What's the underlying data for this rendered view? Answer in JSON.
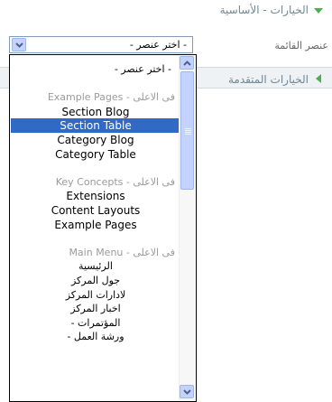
{
  "sections": {
    "basic_title": "الخيارات - الأساسية",
    "advanced_title": "الخيارات المتقدمة"
  },
  "menu_item_field": {
    "label": "عنصر القائمة",
    "selected_value": "- اختر عنصر -"
  },
  "dropdown": {
    "options": [
      {
        "text": "- اختر عنصر -",
        "kind": "first"
      },
      {
        "text": "",
        "kind": "blank"
      },
      {
        "text": "Example Pages - فى الاعلى",
        "kind": "group"
      },
      {
        "text": "Section Blog",
        "kind": "item"
      },
      {
        "text": "Section Table",
        "kind": "selected"
      },
      {
        "text": "Category Blog",
        "kind": "item"
      },
      {
        "text": "Category Table",
        "kind": "item"
      },
      {
        "text": "",
        "kind": "blank"
      },
      {
        "text": "Key Concepts - فى الاعلى",
        "kind": "group"
      },
      {
        "text": "Extensions",
        "kind": "item"
      },
      {
        "text": "Content Layouts",
        "kind": "item"
      },
      {
        "text": "Example Pages",
        "kind": "item"
      },
      {
        "text": "",
        "kind": "blank"
      },
      {
        "text": "Main Menu - فى الاعلى",
        "kind": "group"
      },
      {
        "text": "الرئيسية",
        "kind": "ar"
      },
      {
        "text": "جول المركز",
        "kind": "ar"
      },
      {
        "text": "لادارات المركز",
        "kind": "ar"
      },
      {
        "text": "اخبار المركز",
        "kind": "ar"
      },
      {
        "text": "- المؤتمرات",
        "kind": "ar"
      },
      {
        "text": "- ورشة العمل",
        "kind": "ar"
      }
    ],
    "scroll_position": 0
  },
  "colors": {
    "selection": "#316ac5",
    "section_title": "#6f8796",
    "triangle": "#4caf50",
    "scroll_button": "#c3d3fd"
  },
  "icons": {
    "section_open": "triangle-down-icon",
    "section_closed": "triangle-left-icon",
    "dropdown_arrow": "chevron-down-icon",
    "scroll_up": "chevron-up-icon",
    "scroll_down": "chevron-down-icon"
  }
}
